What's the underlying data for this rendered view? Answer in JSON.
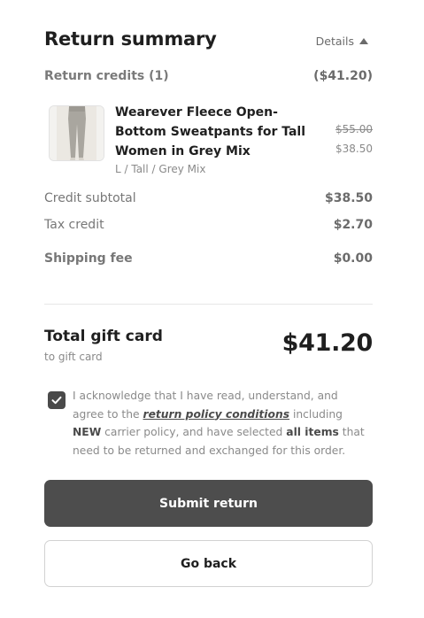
{
  "summary": {
    "title": "Return summary",
    "details_label": "Details"
  },
  "credits": {
    "label": "Return credits (1)",
    "amount": "($41.20)"
  },
  "item": {
    "name": "Wearever Fleece Open-Bottom Sweatpants for Tall Women in Grey Mix",
    "variant": "L / Tall / Grey Mix",
    "original_price": "$55.00",
    "price": "$38.50"
  },
  "totals": {
    "credit_subtotal_label": "Credit subtotal",
    "credit_subtotal_value": "$38.50",
    "tax_credit_label": "Tax credit",
    "tax_credit_value": "$2.70",
    "shipping_fee_label": "Shipping fee",
    "shipping_fee_value": "$0.00"
  },
  "gift_card": {
    "title": "Total gift card",
    "subtitle": "to gift card",
    "amount": "$41.20"
  },
  "acknowledgement": {
    "checked": true,
    "part1": "I acknowledge that I have read, understand, and agree to the ",
    "link": "return policy conditions",
    "part2": " including ",
    "new_word": "NEW",
    "part3": " carrier policy, and have selected ",
    "all_items": "all items",
    "part4": " that need to be returned and exchanged for this order."
  },
  "buttons": {
    "submit": "Submit return",
    "back": "Go back"
  },
  "colors": {
    "primary_button": "#4d4d4d",
    "checkbox": "#4a4a4a",
    "text_muted": "#8a8a8a"
  }
}
